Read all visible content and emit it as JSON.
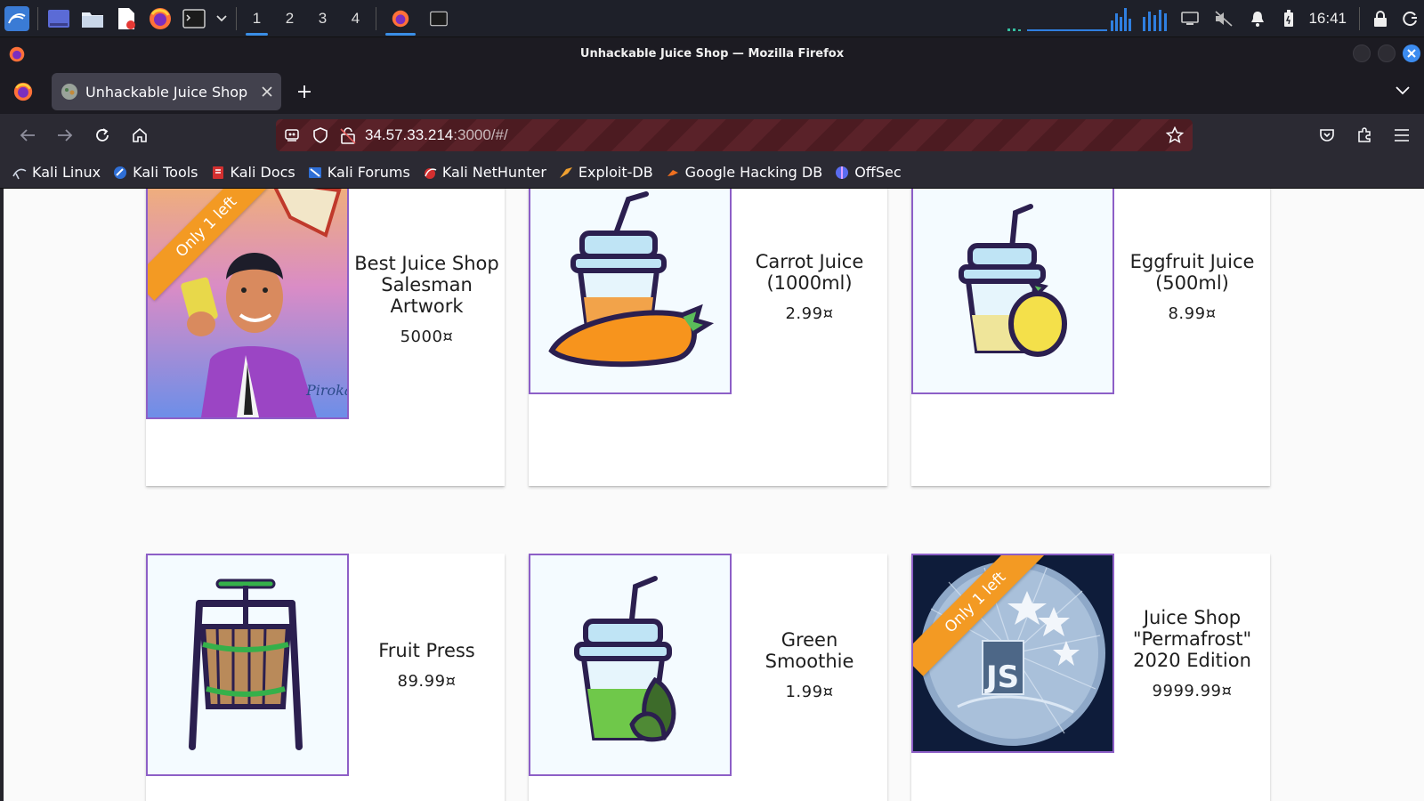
{
  "taskbar": {
    "workspaces": [
      "1",
      "2",
      "3",
      "4"
    ],
    "active_workspace": "1",
    "clock": "16:41",
    "icons": [
      "kali-menu-icon",
      "desktop-icon",
      "file-manager-icon",
      "text-editor-icon",
      "firefox-icon",
      "terminal-icon",
      "dropdown-icon"
    ]
  },
  "window": {
    "title": "Unhackable Juice Shop — Mozilla Firefox"
  },
  "tabs": [
    {
      "label": "Unhackable Juice Shop",
      "active": true
    }
  ],
  "navbar": {
    "url_host": "34.57.33.214",
    "url_rest": ":3000/#/"
  },
  "bookmarks": [
    {
      "label": "Kali Linux",
      "color": "#3b4252"
    },
    {
      "label": "Kali Tools",
      "color": "#2f6fd6"
    },
    {
      "label": "Kali Docs",
      "color": "#d32f2f"
    },
    {
      "label": "Kali Forums",
      "color": "#2f6fd6"
    },
    {
      "label": "Kali NetHunter",
      "color": "#d32f2f"
    },
    {
      "label": "Exploit-DB",
      "color": "#f0a030"
    },
    {
      "label": "Google Hacking DB",
      "color": "#f07020"
    },
    {
      "label": "OffSec",
      "color": "#5a6cf0"
    }
  ],
  "products": [
    {
      "name": "Best Juice Shop Salesman Artwork",
      "price": "5000¤",
      "ribbon": "Only 1 left",
      "image": "salesman-artwork"
    },
    {
      "name": "Carrot Juice (1000ml)",
      "price": "2.99¤",
      "image": "carrot-juice"
    },
    {
      "name": "Eggfruit Juice (500ml)",
      "price": "8.99¤",
      "image": "eggfruit-juice"
    },
    {
      "name": "Fruit Press",
      "price": "89.99¤",
      "image": "fruit-press"
    },
    {
      "name": "Green Smoothie",
      "price": "1.99¤",
      "image": "green-smoothie"
    },
    {
      "name": "Juice Shop \"Permafrost\" 2020 Edition",
      "price": "9999.99¤",
      "ribbon": "Only 1 left",
      "image": "permafrost-coin"
    }
  ],
  "colors": {
    "ribbon": "#f39a23",
    "image_border": "#8d5fc7",
    "url_bar_stripe": "#5a2229"
  }
}
